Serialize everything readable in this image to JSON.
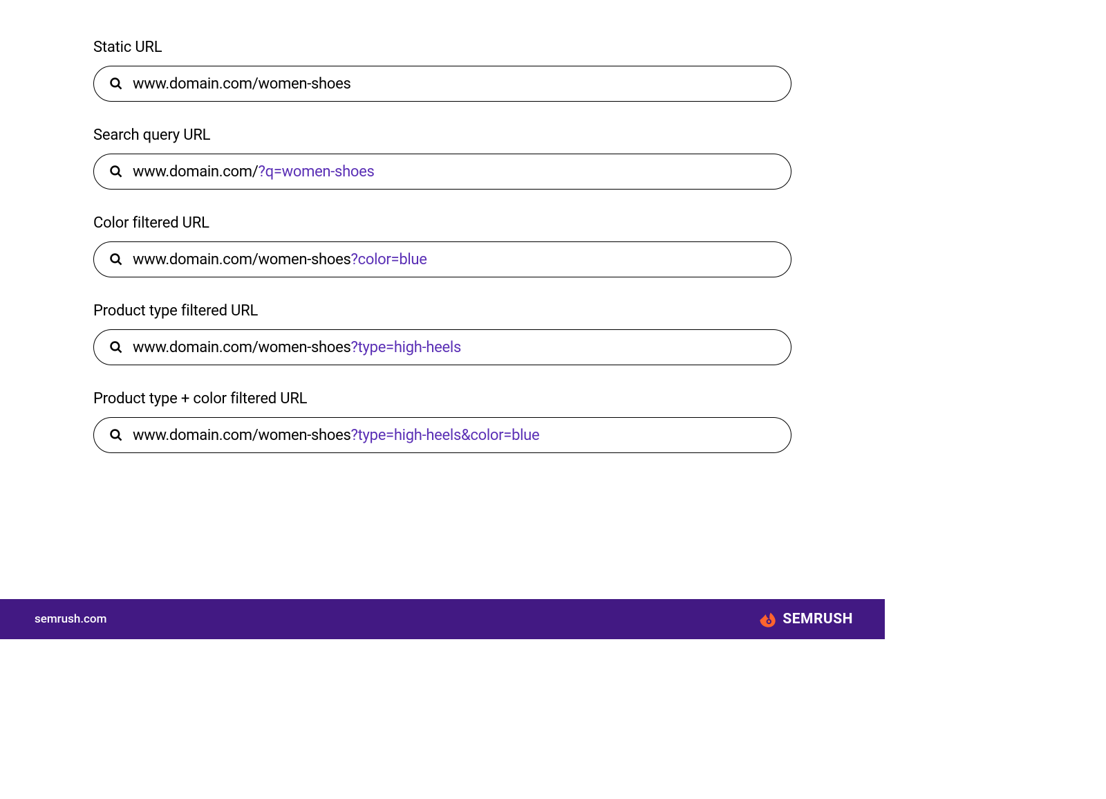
{
  "examples": [
    {
      "label": "Static URL",
      "url_base": "www.domain.com/women-shoes",
      "url_param": ""
    },
    {
      "label": "Search query URL",
      "url_base": "www.domain.com/",
      "url_param": "?q=women-shoes"
    },
    {
      "label": "Color filtered URL",
      "url_base": "www.domain.com/women-shoes",
      "url_param": "?color=blue"
    },
    {
      "label": "Product type filtered URL",
      "url_base": "www.domain.com/women-shoes",
      "url_param": "?type=high-heels"
    },
    {
      "label": "Product type + color filtered URL",
      "url_base": "www.domain.com/women-shoes",
      "url_param": "?type=high-heels&color=blue"
    }
  ],
  "footer": {
    "url": "semrush.com",
    "brand": "SEMRUSH"
  },
  "colors": {
    "accent": "#5a2fb5",
    "footer_bg": "#421983",
    "brand_orange": "#ff642d"
  }
}
